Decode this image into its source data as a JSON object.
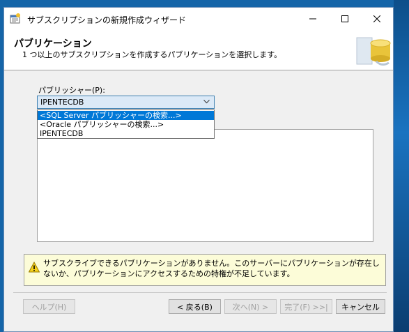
{
  "window": {
    "title": "サブスクリプションの新規作成ウィザード"
  },
  "header": {
    "title": "パブリケーション",
    "subtitle": "1 つ以上のサブスクリプションを作成するパブリケーションを選択します。"
  },
  "publisher": {
    "label": "パブリッシャー(P):",
    "selected": "IPENTECDB",
    "options": [
      "<SQL Server パブリッシャーの検索...>",
      "<Oracle パブリッシャーの検索...>",
      "IPENTECDB"
    ],
    "highlighted_index": 0
  },
  "warning": {
    "text": "サブスクライブできるパブリケーションがありません。このサーバーにパブリケーションが存在しないか、パブリケーションにアクセスするための特権が不足しています。"
  },
  "buttons": {
    "help": "ヘルプ(H)",
    "back": "< 戻る(B)",
    "next": "次へ(N) >",
    "finish": "完了(F) >>|",
    "cancel": "キャンセル"
  },
  "colors": {
    "selection": "#0078d7",
    "combo_focus": "#dbe9f7",
    "warning_bg": "#fcfcd8"
  }
}
